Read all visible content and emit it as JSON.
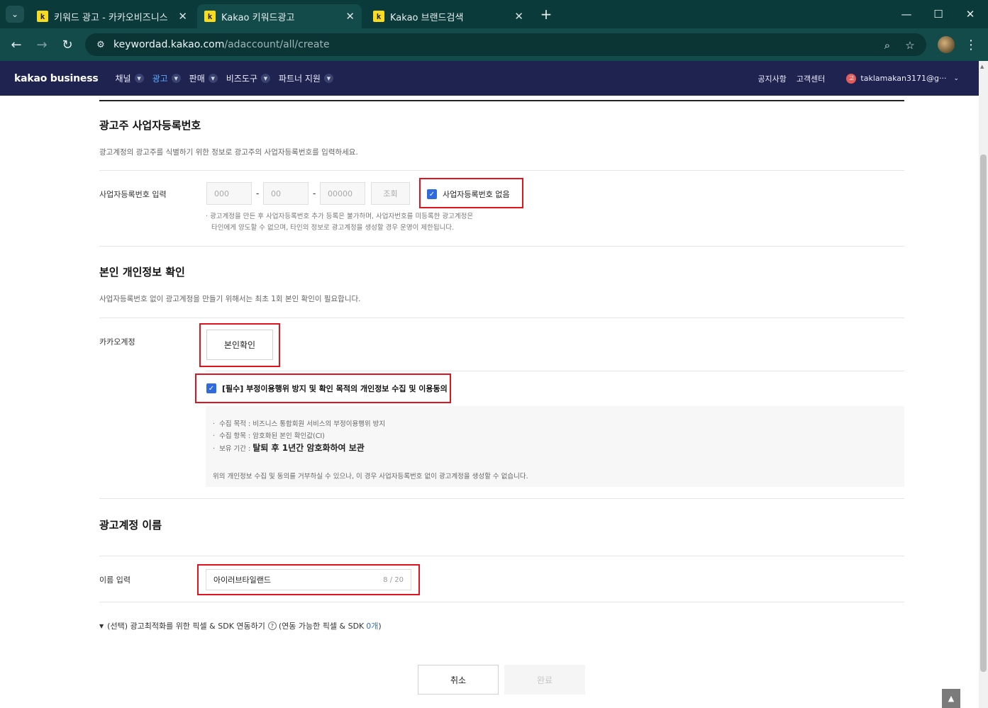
{
  "browser": {
    "tabs": [
      {
        "title": "키워드 광고 - 카카오비즈니스",
        "favicon": "k"
      },
      {
        "title": "Kakao 키워드광고",
        "favicon": "k"
      },
      {
        "title": "Kakao 브랜드검색",
        "favicon": "k"
      }
    ],
    "url_host": "keywordad.kakao.com",
    "url_path": "/adaccount/all/create"
  },
  "header": {
    "logo": "kakao business",
    "nav": [
      "채널",
      "광고",
      "판매",
      "비즈도구",
      "파트너 지원"
    ],
    "active_nav": "광고",
    "notice": "공지사항",
    "support": "고객센터",
    "avatar_initial": "고",
    "account": "taklamakan3171@g···"
  },
  "section_business": {
    "title": "광고주 사업자등록번호",
    "desc": "광고계정의 광고주를 식별하기 위한 정보로 광고주의 사업자등록번호를 입력하세요.",
    "label": "사업자등록번호 입력",
    "ph1": "000",
    "ph2": "00",
    "ph3": "00000",
    "dash": "-",
    "lookup": "조회",
    "no_number": "사업자등록번호 없음",
    "note_line1": "광고계정을 만든 후 사업자등록번호 추가 등록은 불가하며, 사업자번호를 미등록한 광고계정은",
    "note_line2": "타인에게 양도할 수 없으며, 타인의 정보로 광고계정을 생성할 경우 운영이 제한됩니다."
  },
  "section_identity": {
    "title": "본인 개인정보 확인",
    "desc": "사업자등록번호 없이 광고계정을 만들기 위해서는 최초 1회 본인 확인이 필요합니다.",
    "label": "카카오계정",
    "verify_button": "본인확인",
    "consent": "[필수] 부정이용행위 방지 및 확인 목적의 개인정보 수집 및 이용동의",
    "purpose": "수집 목적 : 비즈니스 통합회원 서비스의 부정이용행위 방지",
    "items": "수집 항목 : 암호화된 본인 확인값(CI)",
    "retention_prefix": "보유 기간 :",
    "retention_value": "탈퇴 후 1년간 암호화하여 보관",
    "refuse_note": "위의 개인정보 수집 및 동의를 거부하실 수 있으나, 이 경우 사업자등록번호 없이 광고계정을 생성할 수 없습니다."
  },
  "section_name": {
    "title": "광고계정 이름",
    "label": "이름 입력",
    "value": "아이러브타일랜드",
    "counter": "8 / 20"
  },
  "pixel": {
    "prefix": "(선택) 광고최적화를 위한 픽셀 & SDK 연동하기",
    "suffix_start": "(연동 가능한 픽셀 & SDK",
    "count": "0개",
    "suffix_end": ")"
  },
  "actions": {
    "cancel": "취소",
    "done": "완료"
  }
}
